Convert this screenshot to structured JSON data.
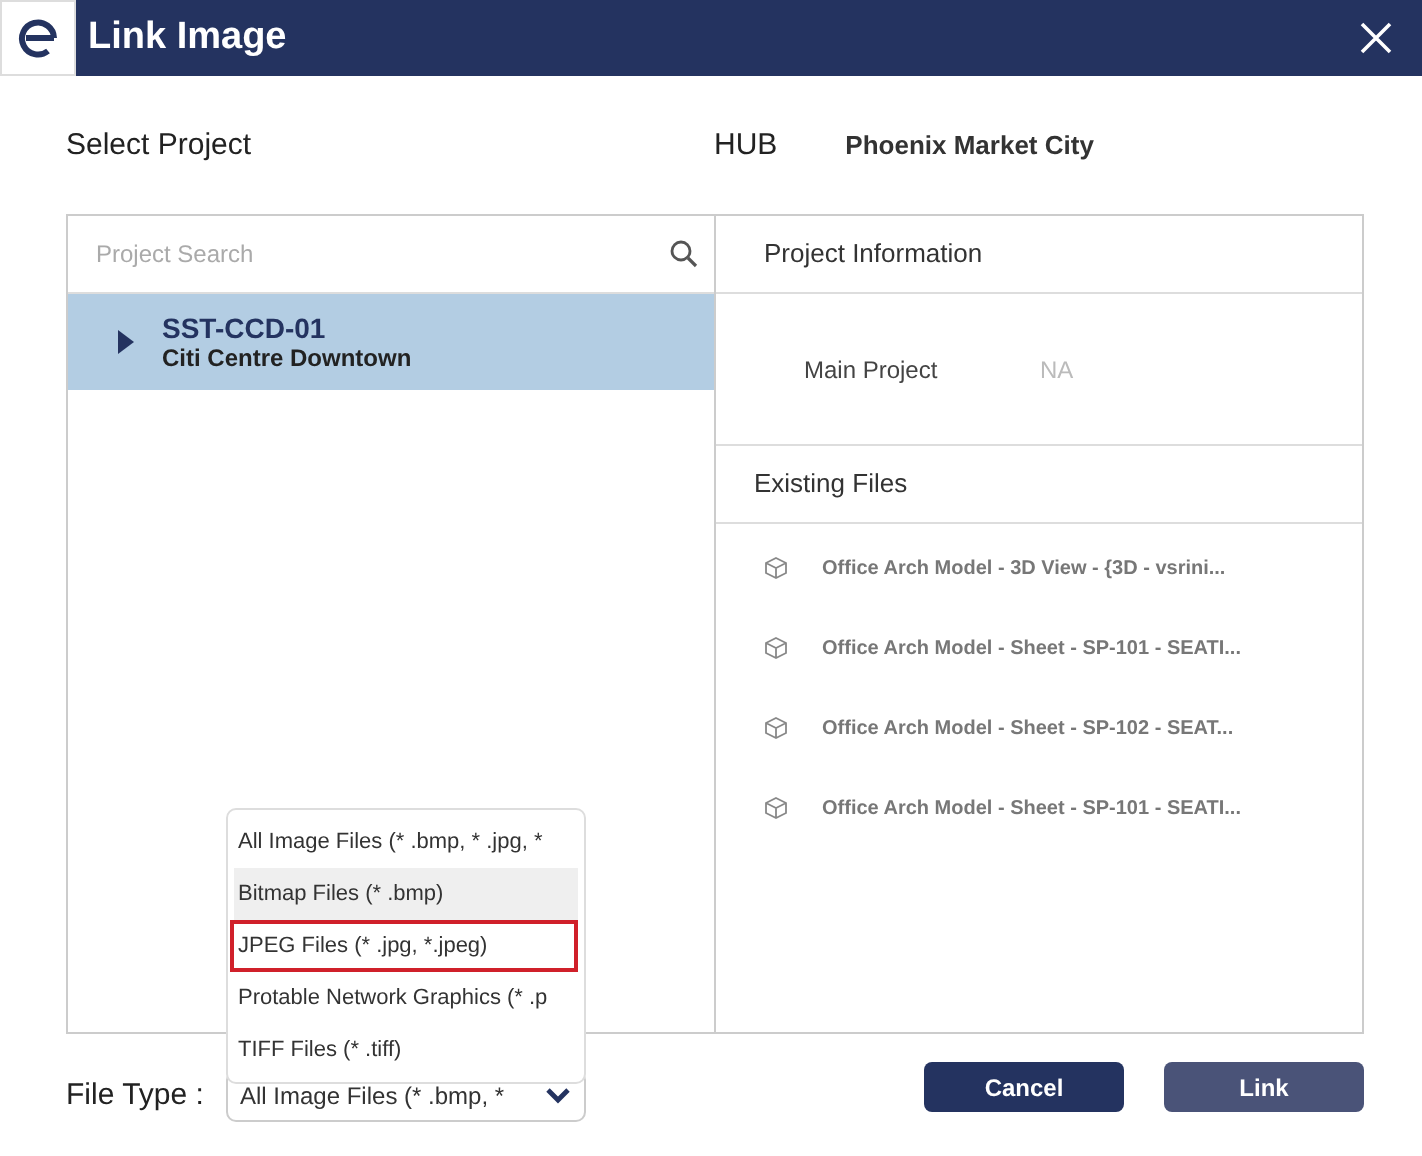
{
  "window": {
    "title": "Link Image"
  },
  "select_project_label": "Select Project",
  "hub": {
    "label": "HUB",
    "value": "Phoenix Market City"
  },
  "search": {
    "placeholder": "Project Search"
  },
  "projects": [
    {
      "code": "SST-CCD-01",
      "name": "Citi Centre Downtown",
      "selected": true
    }
  ],
  "project_information": {
    "title": "Project Information",
    "fields": [
      {
        "label": "Main Project",
        "value": "NA"
      }
    ]
  },
  "existing_files": {
    "title": "Existing Files",
    "items": [
      {
        "name": "Office Arch Model - 3D View - {3D - vsrini..."
      },
      {
        "name": "Office Arch Model - Sheet - SP-101 - SEATI..."
      },
      {
        "name": "Office Arch Model - Sheet - SP-102 - SEAT..."
      },
      {
        "name": "Office Arch Model - Sheet - SP-101 - SEATI..."
      }
    ]
  },
  "file_type": {
    "label": "File Type :",
    "value": "All Image Files (* .bmp, *",
    "expanded": true,
    "options": [
      {
        "label": "All Image Files (* .bmp, * .jpg, *",
        "hovered": false,
        "outlined": false
      },
      {
        "label": "Bitmap Files (* .bmp)",
        "hovered": true,
        "outlined": false
      },
      {
        "label": "JPEG Files (* .jpg, *.jpeg)",
        "hovered": false,
        "outlined": true
      },
      {
        "label": "Protable Network Graphics (* .p",
        "hovered": false,
        "outlined": false
      },
      {
        "label": "TIFF Files (* .tiff)",
        "hovered": false,
        "outlined": false
      }
    ]
  },
  "buttons": [
    {
      "label": "Cancel",
      "kind": "secondary"
    },
    {
      "label": "Link",
      "kind": "primary"
    }
  ]
}
